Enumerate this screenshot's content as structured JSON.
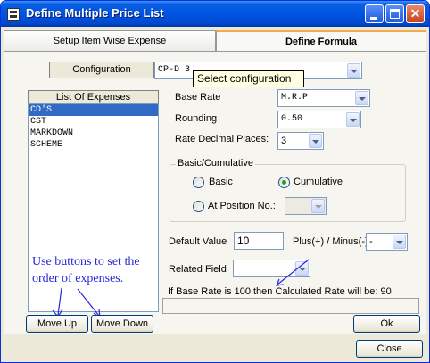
{
  "window": {
    "title": "Define Multiple Price List",
    "controls": {
      "minimize": "minimize",
      "maximize": "maximize",
      "close_glyph": "✕"
    }
  },
  "tabs": [
    {
      "label": "Setup Item Wise Expense",
      "active": false
    },
    {
      "label": "Define Formula",
      "active": true
    }
  ],
  "configuration": {
    "label": "Configuration",
    "value": "CP-D 3",
    "tooltip": "Select configuration"
  },
  "expenses": {
    "title": "List Of Expenses",
    "items": [
      "CD'S",
      "CST",
      "MARKDOWN",
      "SCHEME"
    ],
    "selected_index": 0
  },
  "base_rate": {
    "label": "Base Rate",
    "value": "M.R.P"
  },
  "rounding": {
    "label": "Rounding",
    "value": "0.50"
  },
  "decimal_places": {
    "label": "Rate Decimal Places:",
    "value": "3"
  },
  "mode": {
    "legend": "Basic/Cumulative",
    "basic_label": "Basic",
    "cumulative_label": "Cumulative",
    "position_label": "At Position No.:",
    "selected": "cumulative"
  },
  "default_value": {
    "label": "Default Value",
    "value": "10"
  },
  "plus_minus": {
    "label": "Plus(+) / Minus(-)",
    "value": "-"
  },
  "related_field": {
    "label": "Related Field",
    "value": ""
  },
  "calculation_note": "If Base Rate is 100 then Calculated Rate will be: 90",
  "annotation": "Use buttons to set the order of expenses.",
  "buttons": {
    "move_up": "Move Up",
    "move_down": "Move Down",
    "ok": "Ok",
    "close": "Close"
  },
  "colors": {
    "title_bar": "#0054e3",
    "selection": "#316ac5",
    "annotation": "#2727d8",
    "tooltip_bg": "#ffffe1"
  }
}
